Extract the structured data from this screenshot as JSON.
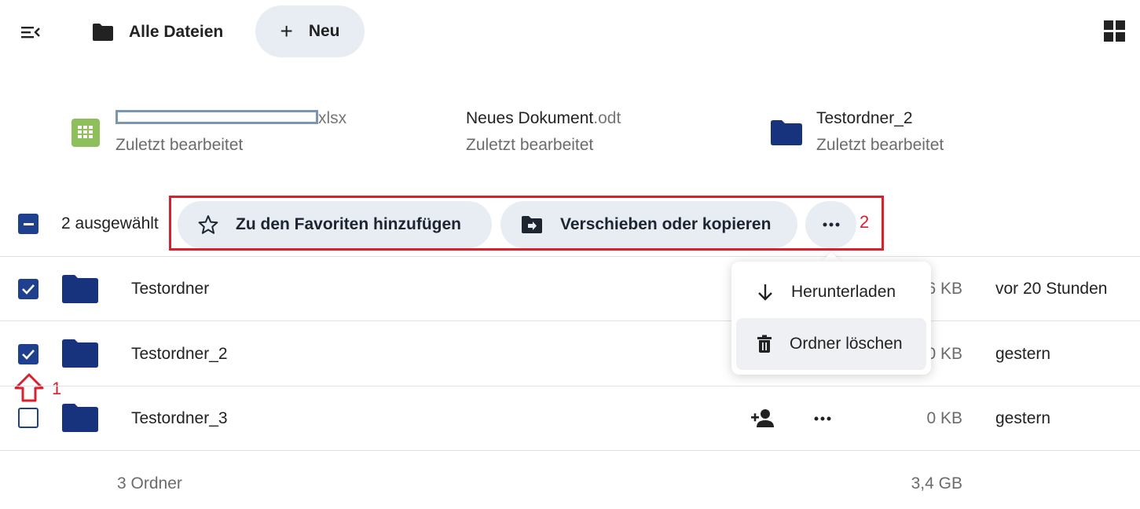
{
  "header": {
    "breadcrumb_label": "Alle Dateien",
    "new_button_label": "Neu",
    "new_button_icon": "+"
  },
  "recent": [
    {
      "name_redacted": true,
      "ext": "xlsx",
      "sub": "Zuletzt bearbeitet",
      "icon": "spreadsheet-icon"
    },
    {
      "name": "Neues Dokument",
      "ext": ".odt",
      "sub": "Zuletzt bearbeitet",
      "icon": "none"
    },
    {
      "name": "Testordner_2",
      "ext": "",
      "sub": "Zuletzt bearbeitet",
      "icon": "folder-icon"
    }
  ],
  "selection": {
    "count_label": "2 ausgewählt",
    "favorite_label": "Zu den Favoriten hinzufügen",
    "move_label": "Verschieben oder kopieren",
    "annotation_number": "2"
  },
  "rows": [
    {
      "name": "Testordner",
      "size": "6 KB",
      "modified": "vor 20 Stunden",
      "checked": true
    },
    {
      "name": "Testordner_2",
      "size": "0 KB",
      "modified": "gestern",
      "checked": true
    },
    {
      "name": "Testordner_3",
      "size": "0 KB",
      "modified": "gestern",
      "checked": false
    }
  ],
  "row_annotation_number": "1",
  "menu": {
    "download_label": "Herunterladen",
    "delete_label": "Ordner löschen"
  },
  "footer": {
    "count_label": "3 Ordner",
    "total_size": "3,4 GB"
  },
  "colors": {
    "accent": "#1f3f8f",
    "folder": "#17337d",
    "pill_bg": "#e8edf4",
    "annotation_red": "#d9202f",
    "spreadsheet_green": "#8fbf5a"
  }
}
